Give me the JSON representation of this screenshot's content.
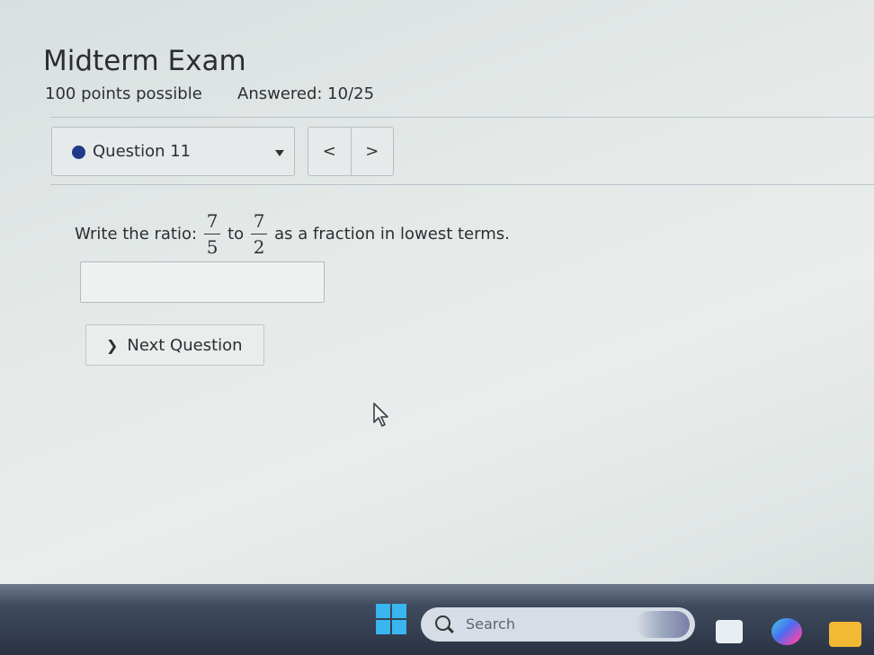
{
  "exam": {
    "title": "Midterm Exam",
    "points": "100 points possible",
    "answered": "Answered: 10/25"
  },
  "question_nav": {
    "selected": "Question 11",
    "prev_label": "<",
    "next_label": ">"
  },
  "question": {
    "prefix": "Write the ratio:",
    "frac1": {
      "num": "7",
      "den": "5"
    },
    "connector": "to",
    "frac2": {
      "num": "7",
      "den": "2"
    },
    "suffix": "as a fraction in lowest terms.",
    "answer_value": ""
  },
  "next_question": {
    "label": "Next Question"
  },
  "taskbar": {
    "search_placeholder": "Search"
  },
  "colors": {
    "accent_dot": "#1f3a8a",
    "windows_logo": "#39b5f0"
  }
}
